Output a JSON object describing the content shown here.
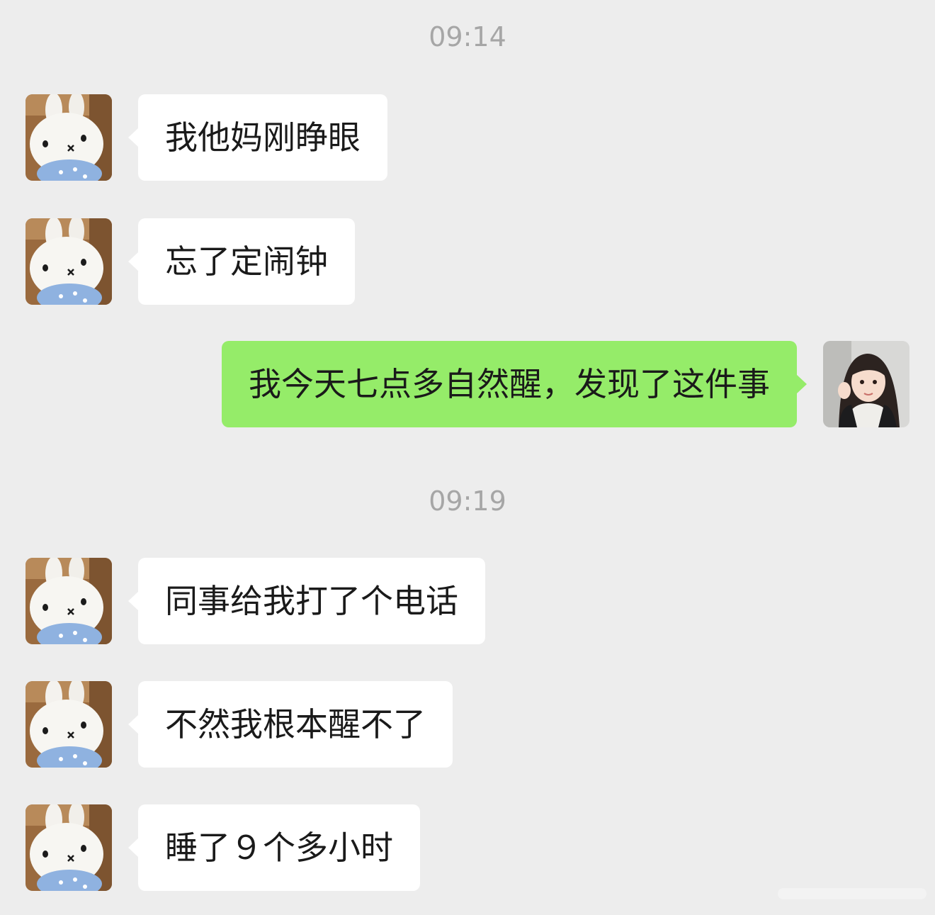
{
  "timestamps": [
    "09:14",
    "09:19"
  ],
  "messages": [
    {
      "sender": "contact",
      "text": "我他妈刚睁眼"
    },
    {
      "sender": "contact",
      "text": "忘了定闹钟"
    },
    {
      "sender": "me",
      "text": "我今天七点多自然醒，发现了这件事"
    },
    {
      "sender": "contact",
      "text": "同事给我打了个电话"
    },
    {
      "sender": "contact",
      "text": "不然我根本醒不了"
    },
    {
      "sender": "contact",
      "text": "睡了９个多小时"
    }
  ],
  "avatars": {
    "contact": "plush-bunny-avatar",
    "me": "girl-photo-avatar"
  },
  "colors": {
    "background": "#ededed",
    "incoming_bubble": "#ffffff",
    "outgoing_bubble": "#95ec69",
    "timestamp": "#a6a6a6"
  }
}
